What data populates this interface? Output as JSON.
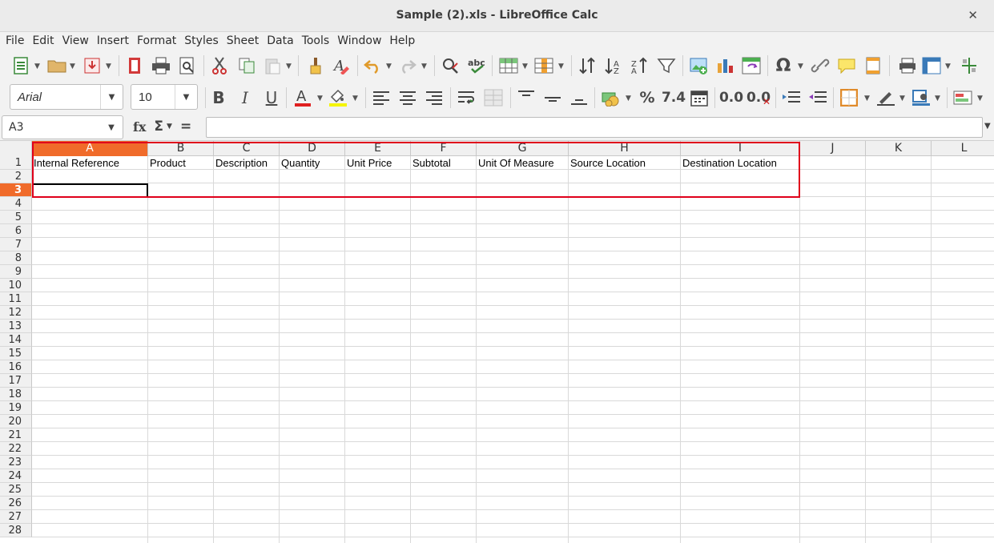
{
  "window": {
    "title": "Sample (2).xls - LibreOffice Calc",
    "close_glyph": "✕"
  },
  "menu": [
    "File",
    "Edit",
    "View",
    "Insert",
    "Format",
    "Styles",
    "Sheet",
    "Data",
    "Tools",
    "Window",
    "Help"
  ],
  "toolbar2": {
    "font_name": "Arial",
    "font_size": "10",
    "bold": "B",
    "italic": "I",
    "underline": "U",
    "percent": "%",
    "number_fmt": "7.4",
    "add_decimal": "0.0",
    "del_decimal": "0.0"
  },
  "formula_bar": {
    "cell_ref": "A3",
    "fx": "fx",
    "sigma": "Σ",
    "equals": "=",
    "content": ""
  },
  "columns": [
    "A",
    "B",
    "C",
    "D",
    "E",
    "F",
    "G",
    "H",
    "I",
    "J",
    "K",
    "L"
  ],
  "active_column": "A",
  "rows": [
    "1",
    "2",
    "3",
    "4",
    "5",
    "6",
    "7",
    "8",
    "9",
    "10",
    "11",
    "12",
    "13",
    "14",
    "15",
    "16",
    "17",
    "18",
    "19",
    "20",
    "21",
    "22",
    "23",
    "24",
    "25",
    "26",
    "27",
    "28"
  ],
  "active_row": "3",
  "headers_row1": [
    "Internal Reference",
    "Product",
    "Description",
    "Quantity",
    "Unit Price",
    "Subtotal",
    "Unit Of Measure",
    "Source Location",
    "Destination Location"
  ],
  "colors": {
    "active_header": "#f06b2a",
    "highlight_box": "#e0001b"
  }
}
